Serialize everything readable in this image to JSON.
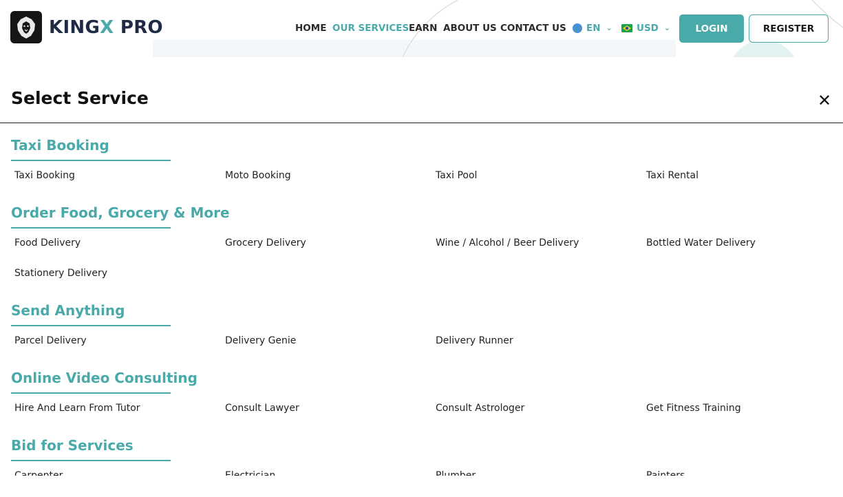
{
  "brand": {
    "name_part1": "KING",
    "name_x": "X",
    "name_part2": " PRO"
  },
  "nav": {
    "items": [
      {
        "label": "HOME"
      },
      {
        "label": "OUR SERVICES"
      },
      {
        "label": "EARN"
      },
      {
        "label": "ABOUT US"
      },
      {
        "label": "CONTACT US"
      }
    ],
    "active": "OUR SERVICES",
    "language": "EN",
    "currency": "USD",
    "login_label": "LOGIN",
    "register_label": "REGISTER"
  },
  "panel": {
    "title": "Select Service",
    "sections": [
      {
        "title": "Taxi Booking",
        "items": [
          "Taxi Booking",
          "Moto Booking",
          "Taxi Pool",
          "Taxi Rental"
        ]
      },
      {
        "title": "Order Food, Grocery & More",
        "items": [
          "Food Delivery",
          "Grocery Delivery",
          "Wine / Alcohol / Beer Delivery",
          "Bottled Water Delivery",
          "Stationery Delivery"
        ]
      },
      {
        "title": "Send Anything",
        "items": [
          "Parcel Delivery",
          "Delivery Genie",
          "Delivery Runner"
        ]
      },
      {
        "title": "Online Video Consulting",
        "items": [
          "Hire And Learn From Tutor",
          "Consult Lawyer",
          "Consult Astrologer",
          "Get Fitness Training"
        ]
      },
      {
        "title": "Bid for Services",
        "items": [
          "Carpenter",
          "Electrician",
          "Plumber",
          "Painters"
        ]
      }
    ]
  },
  "colors": {
    "accent": "#4aa9a9",
    "brand_dark": "#1f2a44",
    "text": "#1a1a1a"
  },
  "icons": {
    "language": "globe-icon",
    "currency": "currency-flag-icon",
    "close": "close-icon",
    "chevron": "chevron-down-icon",
    "logo": "lion-logo-icon"
  }
}
